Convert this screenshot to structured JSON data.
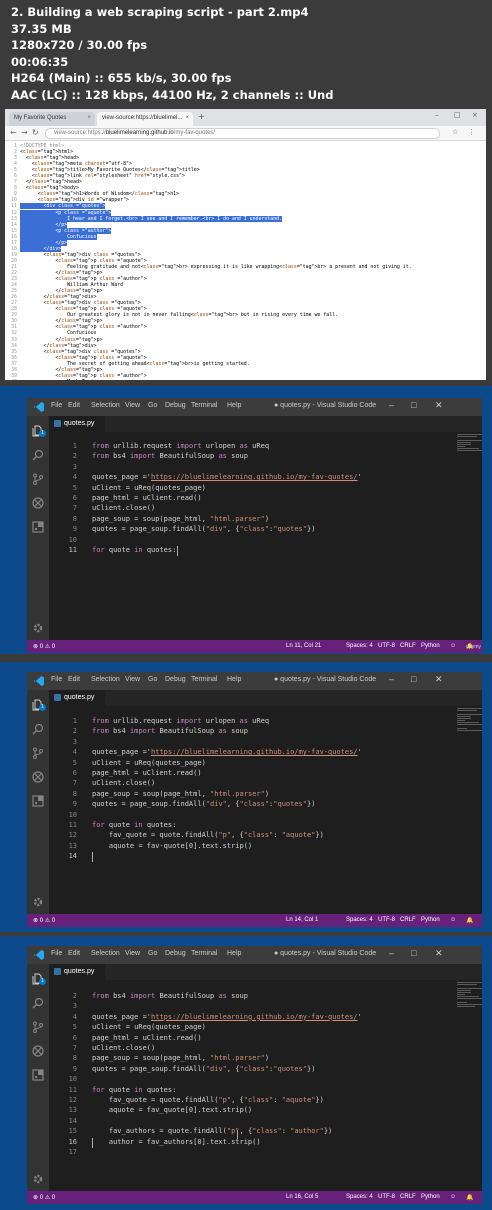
{
  "info": {
    "title": "2. Building a web scraping script - part 2.mp4",
    "size": "37.35 MB",
    "resolution": "1280x720 / 30.00 fps",
    "duration": "00:06:35",
    "video": "H264 (Main) :: 655 kb/s, 30.00 fps",
    "audio": "AAC (LC) :: 128 kbps, 44100 Hz, 2 channels :: Und"
  },
  "browser": {
    "tabs": [
      {
        "label": "My Favorite Quotes",
        "active": false
      },
      {
        "label": "view-source:https://bluelimel...",
        "active": true
      }
    ],
    "address_prefix": "view-source:https://",
    "address_host": "bluelimelearning.github.io",
    "address_path": "/my-fav-quotes/",
    "source_lines": [
      "<!DOCTYPE html>",
      "<html>",
      "  <head>",
      "    <meta charset=\"utf-8\">",
      "    <title>My Favorite Quotes</title>",
      "    <link rel=\"stylesheet\" href=\"style.css\">",
      "  </head>",
      "  <body>",
      "      <h1>Words of Wisdom</h1>",
      "      <div id =\"wrapper\">",
      "        <div class =\"quotes\">",
      "            <p class =\"aquote\">",
      "                I hear and I forget.<br> I see and I remember.<br> I do and I understand.",
      "            </p>",
      "            <p class =\"author\">",
      "                Confucious",
      "            </p>",
      "        </div>",
      "        <div class =\"quotes\">",
      "            <p class =\"aquote\">",
      "                Feeling gratitude and not<br> expressing it is like wrapping<br> a present and not giving it.",
      "            </p>",
      "            <p class =\"author\">",
      "                William Arthur Ward",
      "            </p>",
      "        </div>",
      "        <div class =\"quotes\">",
      "            <p class =\"aquote\">",
      "                Our greatest glory is not in never falling<br> but in rising every time we fall.",
      "            </p>",
      "            <p class =\"author\">",
      "                Confucious",
      "            </p>",
      "        </div>",
      "        <div class =\"quotes\">",
      "            <p class =\"aquote\">",
      "                The secret of getting ahead<br>is getting started.",
      "            </p>",
      "            <p class =\"author\">",
      "                Mark Twain",
      "            </p>",
      "        </div>"
    ]
  },
  "vscode": {
    "menu": [
      "File",
      "Edit",
      "Selection",
      "View",
      "Go",
      "Debug",
      "Terminal",
      "Help"
    ],
    "title": "● quotes.py - Visual Studio Code",
    "tab_label": "quotes.py",
    "frames": [
      {
        "status_right": [
          "Ln 11, Col 21",
          "Spaces: 4",
          "UTF-8",
          "CRLF",
          "Python"
        ],
        "status_left": "⊗ 0 ⚠ 0",
        "badge": "1",
        "lines": [
          {
            "n": "1",
            "code": "from urllib.request import urlopen as uReq"
          },
          {
            "n": "2",
            "code": "from bs4 import BeautifulSoup as soup"
          },
          {
            "n": "3",
            "code": ""
          },
          {
            "n": "4",
            "code": "quotes_page ='https://bluelimelearning.github.io/my-fav-quotes/'"
          },
          {
            "n": "5",
            "code": "uClient = uReq(quotes_page)"
          },
          {
            "n": "6",
            "code": "page_html = uClient.read()"
          },
          {
            "n": "7",
            "code": "uClient.close()"
          },
          {
            "n": "8",
            "code": "page_soup = soup(page_html, \"html.parser\")"
          },
          {
            "n": "9",
            "code": "quotes = page_soup.findAll(\"div\", {\"class\":\"quotes\"})"
          },
          {
            "n": "10",
            "code": ""
          },
          {
            "n": "11",
            "code": "for quote in quotes:"
          }
        ]
      },
      {
        "status_right": [
          "Ln 14, Col 1",
          "Spaces: 4",
          "UTF-8",
          "CRLF",
          "Python"
        ],
        "status_left": "⊗ 0 ⚠ 0",
        "badge": "1",
        "lines": [
          {
            "n": "1",
            "code": "from urllib.request import urlopen as uReq"
          },
          {
            "n": "2",
            "code": "from bs4 import BeautifulSoup as soup"
          },
          {
            "n": "3",
            "code": ""
          },
          {
            "n": "4",
            "code": "quotes_page ='https://bluelimelearning.github.io/my-fav-quotes/'"
          },
          {
            "n": "5",
            "code": "uClient = uReq(quotes_page)"
          },
          {
            "n": "6",
            "code": "page_html = uClient.read()"
          },
          {
            "n": "7",
            "code": "uClient.close()"
          },
          {
            "n": "8",
            "code": "page_soup = soup(page_html, \"html.parser\")"
          },
          {
            "n": "9",
            "code": "quotes = page_soup.findAll(\"div\", {\"class\":\"quotes\"})"
          },
          {
            "n": "10",
            "code": ""
          },
          {
            "n": "11",
            "code": "for quote in quotes:"
          },
          {
            "n": "12",
            "code": "    fav_quote = quote.findAll(\"p\", {\"class\": \"aquote\"})"
          },
          {
            "n": "13",
            "code": "    aquote = fav-quote[0].text.strip()"
          },
          {
            "n": "14",
            "code": ""
          }
        ]
      },
      {
        "status_right": [
          "Ln 16, Col 5",
          "Spaces: 4",
          "UTF-8",
          "CRLF",
          "Python"
        ],
        "status_left": "⊗ 0 ⚠ 0",
        "badge": "1",
        "lines": [
          {
            "n": "2",
            "code": "from bs4 import BeautifulSoup as soup"
          },
          {
            "n": "3",
            "code": ""
          },
          {
            "n": "4",
            "code": "quotes_page ='https://bluelimelearning.github.io/my-fav-quotes/'"
          },
          {
            "n": "5",
            "code": "uClient = uReq(quotes_page)"
          },
          {
            "n": "6",
            "code": "page_html = uClient.read()"
          },
          {
            "n": "7",
            "code": "uClient.close()"
          },
          {
            "n": "8",
            "code": "page_soup = soup(page_html, \"html.parser\")"
          },
          {
            "n": "9",
            "code": "quotes = page_soup.findAll(\"div\", {\"class\":\"quotes\"})"
          },
          {
            "n": "10",
            "code": ""
          },
          {
            "n": "11",
            "code": "for quote in quotes:"
          },
          {
            "n": "12",
            "code": "    fav_quote = quote.findAll(\"p\", {\"class\": \"aquote\"})"
          },
          {
            "n": "13",
            "code": "    aquote = fav_quote[0].text.strip()"
          },
          {
            "n": "14",
            "code": ""
          },
          {
            "n": "15",
            "code": "    fav_authors = quote.findAll(\"p\", {\"class\": \"author\"})"
          },
          {
            "n": "16",
            "code": "    author = fav_authors[0].text.strip()"
          },
          {
            "n": "17",
            "code": ""
          }
        ]
      }
    ],
    "watermark": "udemy",
    "accent": "#68217a",
    "frame_bg": "#0c4a8c"
  }
}
